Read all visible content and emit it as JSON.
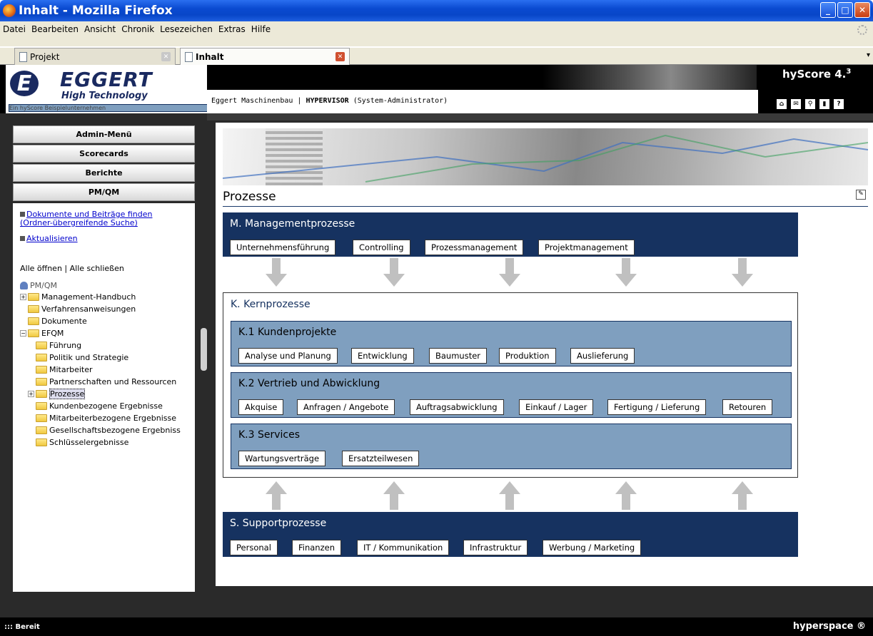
{
  "window": {
    "title": "Inhalt - Mozilla Firefox"
  },
  "menu": [
    "Datei",
    "Bearbeiten",
    "Ansicht",
    "Chronik",
    "Lesezeichen",
    "Extras",
    "Hilfe"
  ],
  "tabs": [
    {
      "label": "Projekt"
    },
    {
      "label": "Inhalt"
    }
  ],
  "header": {
    "brand": "EGGERT",
    "tagline": "High Technology",
    "subtitle": "Ein hyScore Beispielunternehmen",
    "company": "Eggert Maschinenbau |",
    "user": "HYPERVISOR",
    "role": "(System-Administrator)",
    "product": "hyScore 4.",
    "product_sup": "3"
  },
  "nav": {
    "buttons": [
      "Admin-Menü",
      "Scorecards",
      "Berichte",
      "PM/QM"
    ],
    "links": [
      {
        "label": "Dokumente und Beiträge finden (Ordner-übergreifende Suche)"
      },
      {
        "label": "Aktualisieren"
      }
    ],
    "open_all": "Alle öffnen",
    "close_all": "Alle schließen",
    "tree_root": "PM/QM",
    "tree": [
      "Management-Handbuch",
      "Verfahrensanweisungen",
      "Dokumente",
      "EFQM",
      "Führung",
      "Politik und Strategie",
      "Mitarbeiter",
      "Partnerschaften und Ressourcen",
      "Prozesse",
      "Kundenbezogene Ergebnisse",
      "Mitarbeiterbezogene Ergebnisse",
      "Gesellschaftsbezogene Ergebniss",
      "Schlüsselergebnisse"
    ]
  },
  "page": {
    "title": "Prozesse",
    "management": {
      "heading": "M. Managementprozesse",
      "items": [
        "Unternehmensführung",
        "Controlling",
        "Prozessmanagement",
        "Projektmanagement"
      ]
    },
    "kern": {
      "heading": "K. Kernprozesse",
      "k1": {
        "heading": "K.1 Kundenprojekte",
        "items": [
          "Analyse und Planung",
          "Entwicklung",
          "Baumuster",
          "Produktion",
          "Auslieferung"
        ]
      },
      "k2": {
        "heading": "K.2 Vertrieb und Abwicklung",
        "items": [
          "Akquise",
          "Anfragen / Angebote",
          "Auftragsabwicklung",
          "Einkauf / Lager",
          "Fertigung / Lieferung",
          "Retouren"
        ]
      },
      "k3": {
        "heading": "K.3 Services",
        "items": [
          "Wartungsverträge",
          "Ersatzteilwesen"
        ]
      }
    },
    "support": {
      "heading": "S. Supportprozesse",
      "items": [
        "Personal",
        "Finanzen",
        "IT / Kommunikation",
        "Infrastruktur",
        "Werbung / Marketing"
      ]
    }
  },
  "status": {
    "text": "::: Bereit",
    "brand": "hyperspace"
  }
}
